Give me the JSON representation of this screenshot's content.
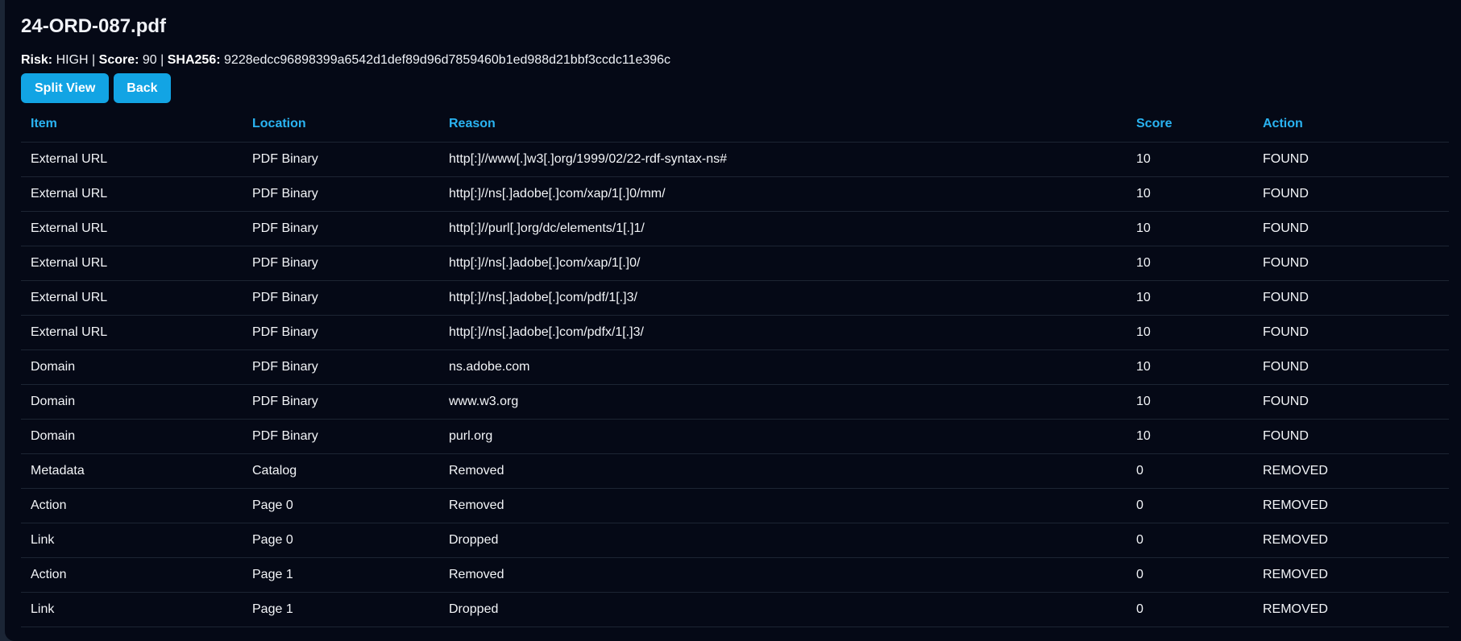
{
  "file": {
    "title": "24-ORD-087.pdf"
  },
  "summary": {
    "risk_label": "Risk:",
    "risk_value": "HIGH",
    "score_label": "Score:",
    "score_value": "90",
    "sha_label": "SHA256:",
    "sha_value": "9228edcc96898399a6542d1def89d96d7859460b1ed988d21bbf3ccdc11e396c",
    "separator": "|"
  },
  "buttons": {
    "split_view": "Split View",
    "back": "Back"
  },
  "colors": {
    "background": "#050916",
    "accent": "#12a4e4",
    "header_text": "#2ab3f1"
  },
  "table": {
    "headers": [
      "Item",
      "Location",
      "Reason",
      "Score",
      "Action"
    ],
    "rows": [
      [
        "External URL",
        "PDF Binary",
        "http[:]//www[.]w3[.]org/1999/02/22-rdf-syntax-ns#",
        "10",
        "FOUND"
      ],
      [
        "External URL",
        "PDF Binary",
        "http[:]//ns[.]adobe[.]com/xap/1[.]0/mm/",
        "10",
        "FOUND"
      ],
      [
        "External URL",
        "PDF Binary",
        "http[:]//purl[.]org/dc/elements/1[.]1/",
        "10",
        "FOUND"
      ],
      [
        "External URL",
        "PDF Binary",
        "http[:]//ns[.]adobe[.]com/xap/1[.]0/",
        "10",
        "FOUND"
      ],
      [
        "External URL",
        "PDF Binary",
        "http[:]//ns[.]adobe[.]com/pdf/1[.]3/",
        "10",
        "FOUND"
      ],
      [
        "External URL",
        "PDF Binary",
        "http[:]//ns[.]adobe[.]com/pdfx/1[.]3/",
        "10",
        "FOUND"
      ],
      [
        "Domain",
        "PDF Binary",
        "ns.adobe.com",
        "10",
        "FOUND"
      ],
      [
        "Domain",
        "PDF Binary",
        "www.w3.org",
        "10",
        "FOUND"
      ],
      [
        "Domain",
        "PDF Binary",
        "purl.org",
        "10",
        "FOUND"
      ],
      [
        "Metadata",
        "Catalog",
        "Removed",
        "0",
        "REMOVED"
      ],
      [
        "Action",
        "Page 0",
        "Removed",
        "0",
        "REMOVED"
      ],
      [
        "Link",
        "Page 0",
        "Dropped",
        "0",
        "REMOVED"
      ],
      [
        "Action",
        "Page 1",
        "Removed",
        "0",
        "REMOVED"
      ],
      [
        "Link",
        "Page 1",
        "Dropped",
        "0",
        "REMOVED"
      ]
    ]
  }
}
